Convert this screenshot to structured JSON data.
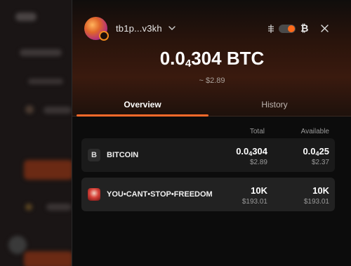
{
  "wallet": {
    "address": "tb1p...v3kh",
    "balance_prefix": "0.0",
    "balance_sub": "4",
    "balance_rest": "304 BTC",
    "balance_usd": "~ $2.89"
  },
  "header": {
    "network_symbol": "₿",
    "toggle_on": true
  },
  "tabs": [
    {
      "label": "Overview",
      "active": true
    },
    {
      "label": "History",
      "active": false
    }
  ],
  "columns": {
    "total": "Total",
    "available": "Available"
  },
  "assets": [
    {
      "icon": "B",
      "name": "BITCOIN",
      "total_prefix": "0.0",
      "total_sub": "4",
      "total_rest": "304",
      "total_usd": "$2.89",
      "available_prefix": "0.0",
      "available_sub": "4",
      "available_rest": "25",
      "available_usd": "$2.37"
    },
    {
      "icon": "",
      "name": "YOU•CANT•STOP•FREEDOM",
      "total": "10K",
      "total_usd": "$193.01",
      "available": "10K",
      "available_usd": "$193.01"
    }
  ],
  "colors": {
    "accent": "#ff6a2a",
    "panel_bg": "#0c0c0c",
    "row_bg": "#1a1a1a"
  }
}
